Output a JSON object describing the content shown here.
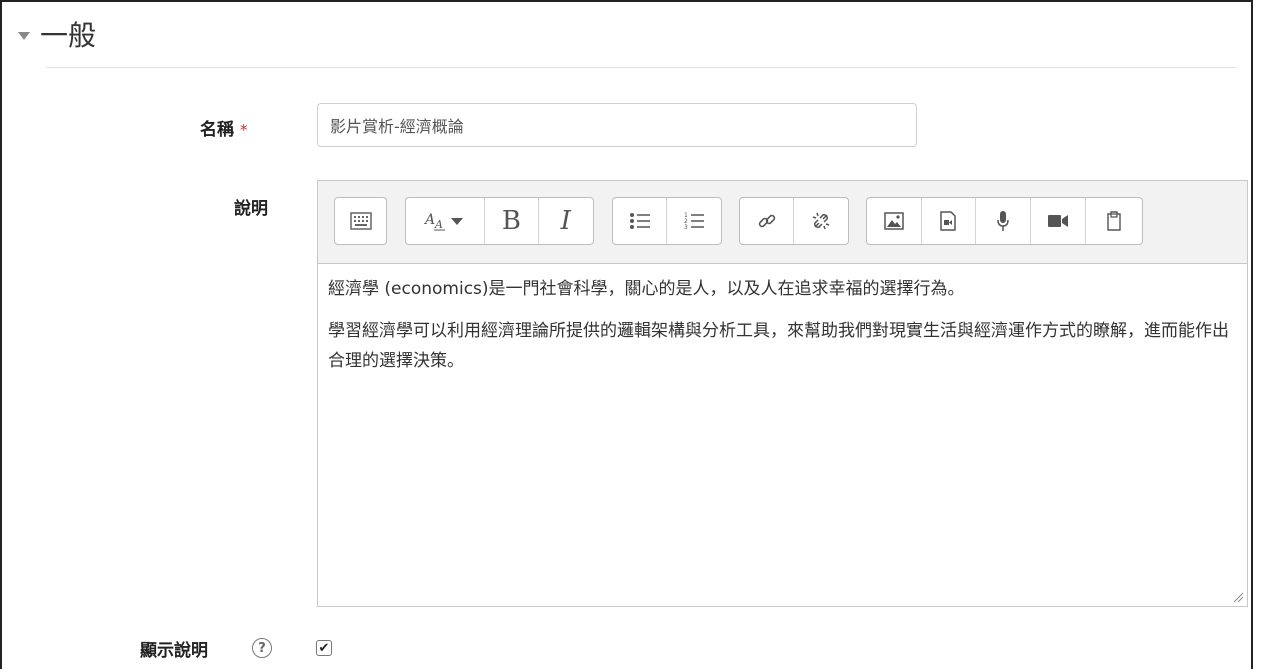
{
  "section": {
    "title": "一般"
  },
  "name_field": {
    "label": "名稱",
    "required_mark": "*",
    "value": "影片賞析-經濟概論"
  },
  "description": {
    "label": "說明",
    "paragraphs": [
      "經濟學 (economics)是一門社會科學，關心的是人，以及人在追求幸福的選擇行為。",
      "學習經濟學可以利用經濟理論所提供的邏輯架構與分析工具，來幫助我們對現實生活與經濟運作方式的瞭解，進而能作出合理的選擇決策。"
    ]
  },
  "toolbar": {
    "groups": [
      [
        "toolbar-toggle-icon"
      ],
      [
        "font-style-icon",
        "bold-icon",
        "italic-icon"
      ],
      [
        "unordered-list-icon",
        "ordered-list-icon"
      ],
      [
        "link-icon",
        "unlink-icon"
      ],
      [
        "image-icon",
        "media-icon",
        "microphone-icon",
        "video-icon",
        "manage-files-icon"
      ]
    ],
    "bold_label": "B",
    "italic_label": "I"
  },
  "show_description": {
    "label": "顯示說明",
    "help_symbol": "?",
    "checked": true,
    "check_mark": "✔"
  }
}
